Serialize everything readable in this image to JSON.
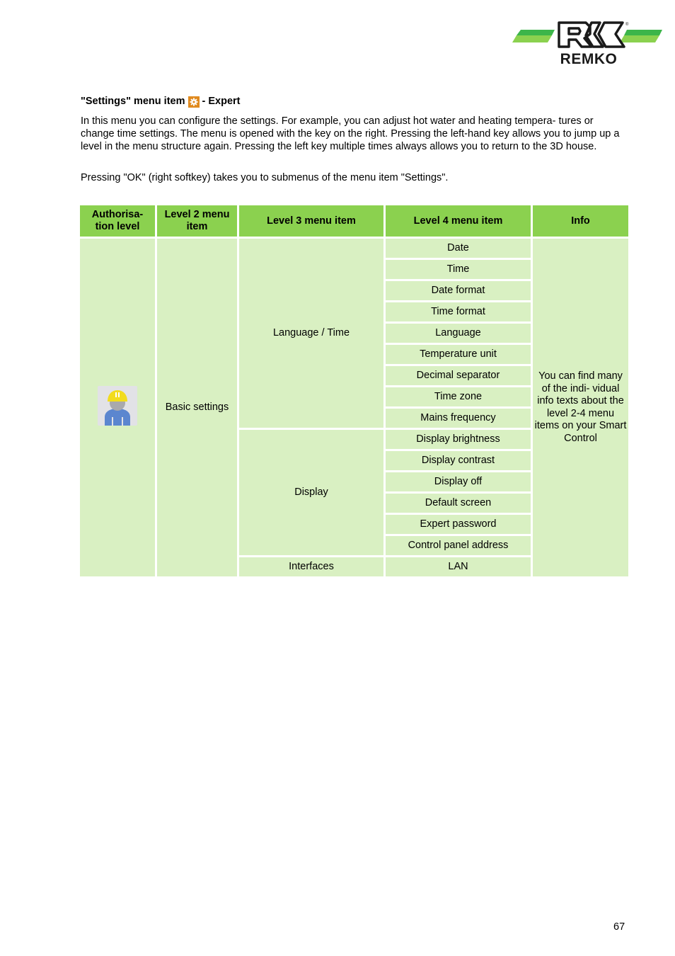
{
  "brand": {
    "name": "REMKO",
    "registered_mark": "®",
    "colors": {
      "green_dark": "#3cb54a",
      "green_light": "#8bd14f",
      "black": "#1a1a1a"
    }
  },
  "heading": {
    "prefix": "\"Settings\" menu item",
    "icon": "gear-icon",
    "suffix": "- Expert"
  },
  "paragraphs": [
    "In this menu you can configure the settings. For example, you can adjust hot water and heating tempera- tures or change time settings. The menu is opened with the key on the right. Pressing the left-hand key allows you to jump up a level in the menu structure again. Pressing the left key multiple times always allows you to return to the 3D house.",
    "Pressing \"OK\" (right softkey) takes you to submenus of the menu item \"Settings\"."
  ],
  "table": {
    "headers": [
      "Authorisa- tion level",
      "Level 2 menu item",
      "Level 3 menu item",
      "Level 4 menu item",
      "Info"
    ],
    "authorisation_icon": "expert-technician-icon",
    "level2": "Basic settings",
    "groups": [
      {
        "level3": "Language / Time",
        "level4": [
          "Date",
          "Time",
          "Date format",
          "Time format",
          "Language",
          "Temperature unit",
          "Decimal separator",
          "Time zone",
          "Mains frequency"
        ]
      },
      {
        "level3": "Display",
        "level4": [
          "Display brightness",
          "Display contrast",
          "Display off",
          "Default screen",
          "Expert password",
          "Control panel address"
        ]
      },
      {
        "level3": "Interfaces",
        "level4": [
          "LAN"
        ]
      }
    ],
    "info": "You can find many of the indi- vidual info texts about the level 2-4 menu items on your Smart Control",
    "colors": {
      "header_bg": "#8bd14f",
      "cell_bg": "#d9f0c2"
    }
  },
  "page_number": "67"
}
